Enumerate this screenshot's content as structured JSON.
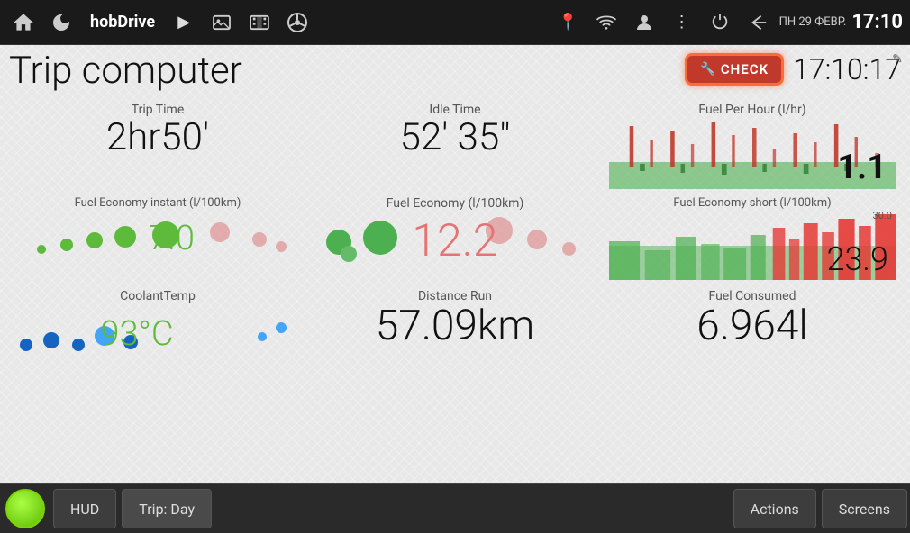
{
  "statusBar": {
    "appName": "hobDrive",
    "date": "ПН 29 ФЕВР.",
    "time": "17:10"
  },
  "header": {
    "title": "Trip computer",
    "currentTime": "17:10:17"
  },
  "checkEngine": {
    "label": "CHECK"
  },
  "metrics": {
    "tripTime": {
      "label": "Trip Time",
      "value": "2hr50'"
    },
    "idleTime": {
      "label": "Idle Time",
      "value": "52' 35\""
    },
    "fuelPerHour": {
      "label": "Fuel Per Hour (l/hr)",
      "value": "1.1"
    },
    "fuelEconomyInstant": {
      "label": "Fuel Economy instant (l/100km)",
      "value": "7.0"
    },
    "fuelEconomy": {
      "label": "Fuel Economy (l/100km)",
      "value": "12.2"
    },
    "fuelEconomyShort": {
      "label": "Fuel Economy short (l/100km)",
      "value": "23.9",
      "maxLabel": "30.0"
    },
    "coolantTemp": {
      "label": "CoolantTemp",
      "value": "93°C"
    },
    "distanceRun": {
      "label": "Distance Run",
      "value": "57.09km"
    },
    "fuelConsumed": {
      "label": "Fuel Consumed",
      "value": "6.964l"
    }
  },
  "bottomNav": {
    "hud": "HUD",
    "trip": "Trip: Day",
    "actions": "Actions",
    "screens": "Screens"
  }
}
